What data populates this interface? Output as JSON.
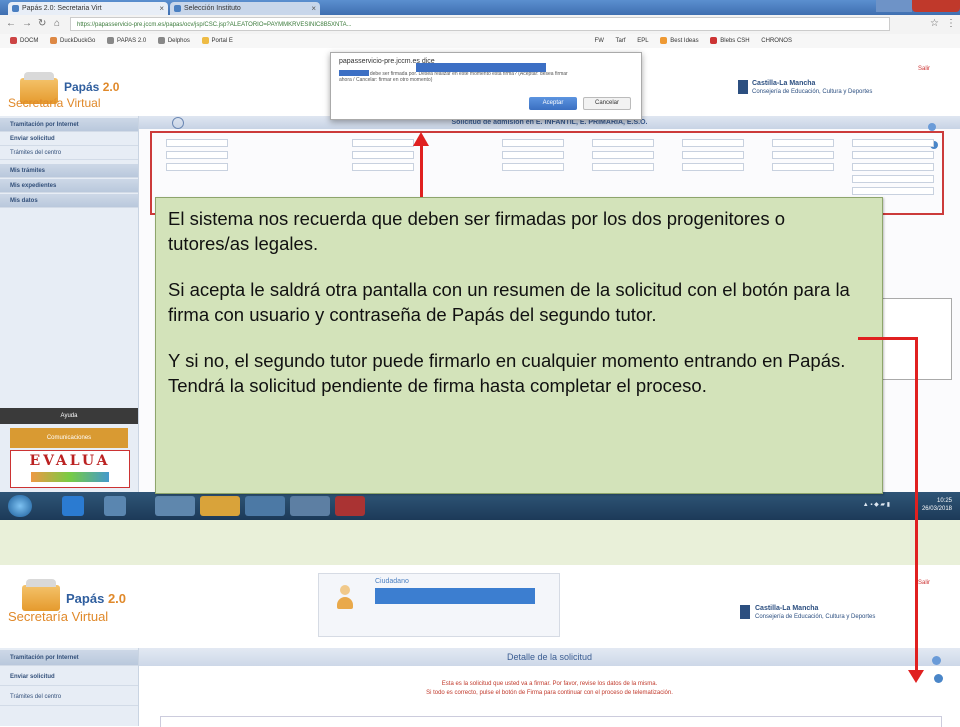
{
  "browser": {
    "tabs": [
      "Papás 2.0: Secretaria Virt",
      "Selección Instituto"
    ],
    "url": "https://papasservicio-pre.jccm.es/papas/ocv/jsp/CSC.jsp?ALEATORIO=PAYMMKRVESINIC8B5XNTA...",
    "bookmarks": [
      "DOCM",
      "DuckDuckGo",
      "PAPAS 2.0",
      "Delphos",
      "Portal E",
      "FW",
      "Tarf",
      "EPL",
      "Best Ideas",
      "Blebs CSH",
      "CHRONOS"
    ]
  },
  "dialog": {
    "title": "papasservicio-pre.jccm.es dice",
    "message": "Esta solicitud debe ser firmada por. Desea realizar en este momento esta firma? (Aceptar: desea firmar ahora / Cancelar: firmar en otro momento)",
    "ok_label": "Aceptar",
    "cancel_label": "Cancelar"
  },
  "app1": {
    "logo_title": "Papás",
    "logo_version": "2.0",
    "logo_sub": "Secretaría Virtual",
    "clm_name": "Castilla-La Mancha",
    "clm_dept": "Consejería de Educación, Cultura y Deportes",
    "salir": "Salir",
    "page_title": "Solicitud de admisión en E. INFANTIL, E. PRIMARIA, E.S.O.",
    "sidebar": [
      {
        "label": "Tramitación por Internet",
        "head": true
      },
      {
        "label": "Enviar solicitud",
        "head": false
      },
      {
        "label": "Trámites del centro",
        "head": false
      },
      {
        "label": "Mis trámites",
        "head": true
      },
      {
        "label": "Mis expedientes",
        "head": true
      },
      {
        "label": "Mis datos",
        "head": true
      }
    ],
    "ayuda": "Ayuda",
    "banner": "Comunicaciones",
    "evalua": "EVALUA"
  },
  "taskbar": {
    "time": "10:25",
    "date": "26/03/2018"
  },
  "app2": {
    "logo_title": "Papás",
    "logo_version": "2.0",
    "logo_sub": "Secretaría Virtual",
    "ciudadano": "Ciudadano",
    "clm_name": "Castilla-La Mancha",
    "clm_dept": "Consejería de Educación, Cultura y Deportes",
    "salir": "Salir",
    "page_title": "Detalle de la solicitud",
    "info_line1": "Esta es la solicitud que usted va a firmar. Por favor, revise los datos de la misma.",
    "info_line2": "Si todo es correcto, pulse el botón de Firma para continuar con el proceso de telematización.",
    "sidebar": [
      {
        "label": "Tramitación por Internet",
        "head": true
      },
      {
        "label": "Enviar solicitud",
        "head": false
      },
      {
        "label": "Trámites del centro",
        "head": false
      }
    ]
  },
  "callout": {
    "p1": "El sistema nos recuerda que deben ser firmadas por los dos progenitores o tutores/as legales.",
    "p2": "Si acepta le saldrá otra pantalla con un resumen de la solicitud con el botón para la firma con usuario y contraseña de Papás del segundo tutor.",
    "p3": "Y si no, el segundo tutor puede firmarlo en cualquier momento entrando en Papás. Tendrá la solicitud pendiente de firma hasta completar el proceso."
  },
  "colors": {
    "callout_bg": "#d3e3ba",
    "arrow": "#e02020",
    "brand_blue": "#2f5e9e",
    "brand_orange": "#e0892a"
  }
}
